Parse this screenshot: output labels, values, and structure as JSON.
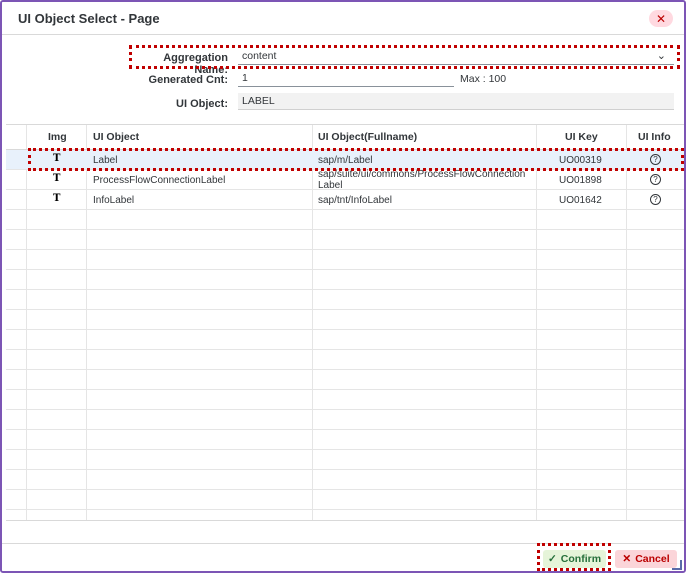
{
  "dialog": {
    "title": "UI Object Select - Page",
    "close_icon": "close-icon"
  },
  "form": {
    "aggregation_label": "Aggregation Name:",
    "aggregation_value": "content",
    "generated_label": "Generated Cnt:",
    "generated_value": "1",
    "max_label": "Max : 100",
    "ui_object_label": "UI Object:",
    "ui_object_value": "LABEL"
  },
  "table": {
    "headers": {
      "img": "Img",
      "ui_object": "UI Object",
      "fullname": "UI Object(Fullname)",
      "ui_key": "UI Key",
      "ui_info": "UI Info"
    },
    "rows": [
      {
        "img": "T",
        "ui_object": "Label",
        "fullname": "sap/m/Label",
        "ui_key": "UO00319",
        "info": "?"
      },
      {
        "img": "T",
        "ui_object": "ProcessFlowConnectionLabel",
        "fullname": "sap/suite/ui/commons/ProcessFlowConnection Label",
        "ui_key": "UO01898",
        "info": "?"
      },
      {
        "img": "T",
        "ui_object": "InfoLabel",
        "fullname": "sap/tnt/InfoLabel",
        "ui_key": "UO01642",
        "info": "?"
      }
    ]
  },
  "footer": {
    "confirm_label": "Confirm",
    "cancel_label": "Cancel"
  },
  "colors": {
    "frame": "#7c55b5",
    "highlight": "#c00000",
    "confirm_bg": "#e5f4d9",
    "cancel_bg": "#fbd5d9"
  }
}
